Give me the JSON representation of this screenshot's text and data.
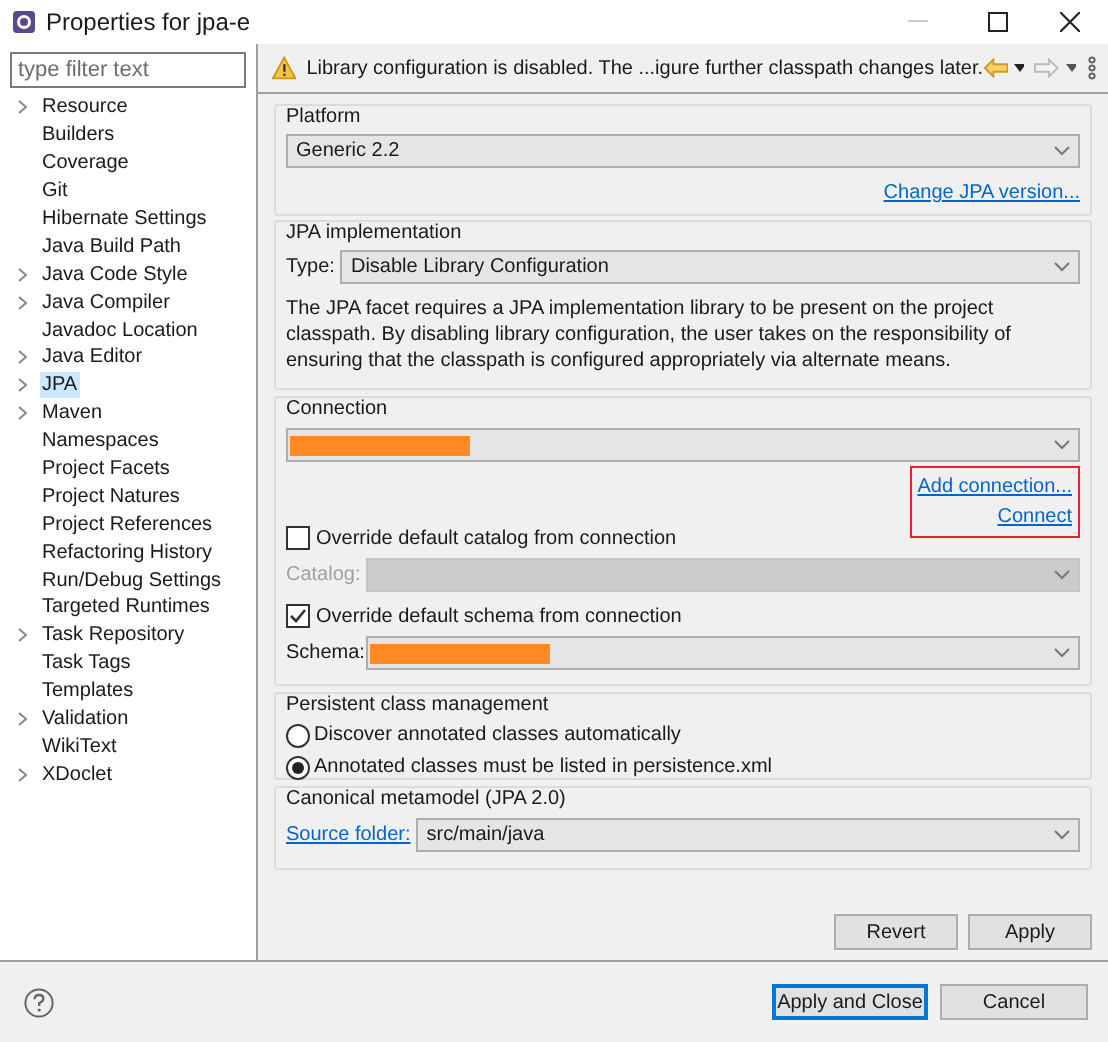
{
  "window": {
    "title": "Properties for jpa-e"
  },
  "sidebar": {
    "filter": {
      "placeholder": "type filter text"
    },
    "items": [
      {
        "label": "Resource",
        "expandable": true,
        "selected": false
      },
      {
        "label": "Builders",
        "expandable": false,
        "selected": false
      },
      {
        "label": "Coverage",
        "expandable": false,
        "selected": false
      },
      {
        "label": "Git",
        "expandable": false,
        "selected": false
      },
      {
        "label": "Hibernate Settings",
        "expandable": false,
        "selected": false
      },
      {
        "label": "Java Build Path",
        "expandable": false,
        "selected": false
      },
      {
        "label": "Java Code Style",
        "expandable": true,
        "selected": false
      },
      {
        "label": "Java Compiler",
        "expandable": true,
        "selected": false
      },
      {
        "label": "Javadoc Location",
        "expandable": false,
        "selected": false
      },
      {
        "label": "Java Editor",
        "expandable": true,
        "selected": false
      },
      {
        "label": "JPA",
        "expandable": true,
        "selected": true
      },
      {
        "label": "Maven",
        "expandable": true,
        "selected": false
      },
      {
        "label": "Namespaces",
        "expandable": false,
        "selected": false
      },
      {
        "label": "Project Facets",
        "expandable": false,
        "selected": false
      },
      {
        "label": "Project Natures",
        "expandable": false,
        "selected": false
      },
      {
        "label": "Project References",
        "expandable": false,
        "selected": false
      },
      {
        "label": "Refactoring History",
        "expandable": false,
        "selected": false
      },
      {
        "label": "Run/Debug Settings",
        "expandable": false,
        "selected": false
      },
      {
        "label": "Targeted Runtimes",
        "expandable": false,
        "selected": false
      },
      {
        "label": "Task Repository",
        "expandable": true,
        "selected": false
      },
      {
        "label": "Task Tags",
        "expandable": false,
        "selected": false
      },
      {
        "label": "Templates",
        "expandable": false,
        "selected": false
      },
      {
        "label": "Validation",
        "expandable": true,
        "selected": false
      },
      {
        "label": "WikiText",
        "expandable": false,
        "selected": false
      },
      {
        "label": "XDoclet",
        "expandable": true,
        "selected": false
      }
    ]
  },
  "message": {
    "text": "Library configuration is disabled. The ...igure further classpath changes later."
  },
  "platform": {
    "label": "Platform",
    "value": "Generic 2.2",
    "link": "Change JPA version..."
  },
  "jpa_implementation": {
    "label": "JPA implementation",
    "type_label": "Type:",
    "type_value": "Disable Library Configuration",
    "description": "The JPA facet requires a JPA implementation library to be present on the project classpath. By disabling library configuration, the user takes on the responsibility of ensuring that the classpath is configured appropriately via alternate means."
  },
  "connection": {
    "label": "Connection",
    "redacted": true,
    "links": [
      "Add connection...",
      "Connect"
    ],
    "links_highlighted": true,
    "override_catalog": {
      "label": "Override default catalog from connection",
      "checked": false
    },
    "catalog": {
      "label": "Catalog:",
      "disabled": true
    },
    "override_schema": {
      "label": "Override default schema from connection",
      "checked": true
    },
    "schema": {
      "label": "Schema:",
      "redacted": true
    }
  },
  "persistent": {
    "label": "Persistent class management",
    "options": [
      {
        "label": "Discover annotated classes automatically",
        "selected": false
      },
      {
        "label": "Annotated classes must be listed in persistence.xml",
        "selected": true
      }
    ]
  },
  "canonical": {
    "label": "Canonical metamodel (JPA 2.0)",
    "link": "Source folder:",
    "value": "src/main/java"
  },
  "page_buttons": [
    "Revert",
    "Apply"
  ],
  "dialog_buttons": [
    {
      "label": "Apply and Close",
      "default": true
    },
    {
      "label": "Cancel",
      "default": false
    }
  ]
}
